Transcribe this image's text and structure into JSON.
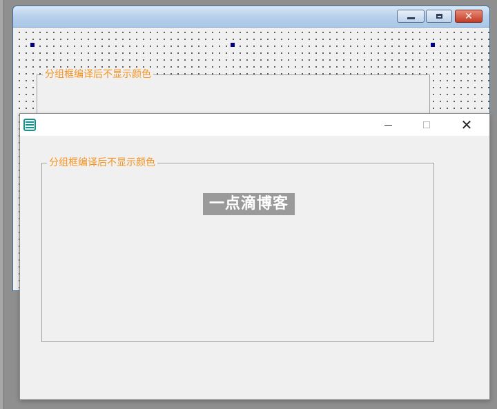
{
  "designer": {
    "title": "",
    "groupbox_label": "分组框编译后不显示颜色"
  },
  "runtime": {
    "title": "",
    "groupbox_label": "分组框编译后不显示颜色",
    "watermark": "一点滴博客"
  },
  "colors": {
    "groupbox_text": "#f7931e",
    "watermark_bg": "#9a9a9a"
  },
  "icons": {
    "designer_minimize": "minimize-icon",
    "designer_maximize": "maximize-icon",
    "designer_close": "close-icon",
    "runtime_app": "app-icon",
    "runtime_minimize": "minimize-icon",
    "runtime_maximize": "maximize-icon",
    "runtime_close": "close-icon"
  }
}
